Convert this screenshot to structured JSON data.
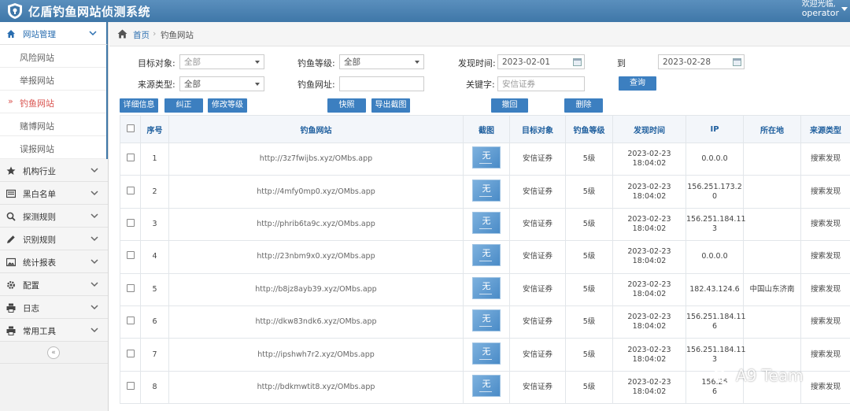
{
  "app": {
    "title": "亿盾钓鱼网站侦测系统"
  },
  "user": {
    "greeting": "欢迎光临,",
    "name": "operator"
  },
  "sidebar": {
    "groups": [
      {
        "label": "网站管理",
        "icon": "home-icon",
        "expanded": true,
        "items": [
          {
            "label": "风险网站"
          },
          {
            "label": "举报网站"
          },
          {
            "label": "钓鱼网站",
            "active": true
          },
          {
            "label": "赌博网站"
          },
          {
            "label": "误报网站"
          }
        ]
      },
      {
        "label": "机构行业",
        "icon": "star-icon"
      },
      {
        "label": "黑白名单",
        "icon": "list-icon"
      },
      {
        "label": "探测规则",
        "icon": "search-icon"
      },
      {
        "label": "识别规则",
        "icon": "pencil-icon"
      },
      {
        "label": "统计报表",
        "icon": "picture-icon"
      },
      {
        "label": "配置",
        "icon": "gear-icon"
      },
      {
        "label": "日志",
        "icon": "printer-icon"
      },
      {
        "label": "常用工具",
        "icon": "printer-icon"
      }
    ],
    "collapse_glyph": "«"
  },
  "breadcrumb": {
    "home": "首页",
    "separator": "›",
    "current": "钓鱼网站"
  },
  "filters": {
    "target_label": "目标对象:",
    "target_value": "全部",
    "level_label": "钓鱼等级:",
    "level_value": "全部",
    "found_label": "发现时间:",
    "found_from": "2023-02-01",
    "to_label": "到",
    "found_to": "2023-02-28",
    "source_label": "来源类型:",
    "source_value": "全部",
    "url_label": "钓鱼网址:",
    "url_value": "",
    "keyword_label": "关键字:",
    "keyword_placeholder": "安信证券",
    "query_button": "查询"
  },
  "toolbar": {
    "detail": "详细信息",
    "correct": "纠正",
    "change_level": "修改等级",
    "snapshot": "快照",
    "export": "导出截图",
    "revert": "撤回",
    "delete": "删除"
  },
  "table": {
    "columns": [
      "序号",
      "钓鱼网站",
      "截图",
      "目标对象",
      "钓鱼等级",
      "发现时间",
      "IP",
      "所在地",
      "来源类型"
    ],
    "thumb_text": "无",
    "rows": [
      {
        "no": "1",
        "url": "http://3z7fwijbs.xyz/OMbs.app",
        "target": "安信证券",
        "level": "5级",
        "time": "2023-02-23 18:04:02",
        "ip": "0.0.0.0",
        "loc": "",
        "src": "搜索发现"
      },
      {
        "no": "2",
        "url": "http://4mfy0mp0.xyz/OMbs.app",
        "target": "安信证券",
        "level": "5级",
        "time": "2023-02-23 18:04:02",
        "ip": "156.251.173.2\n0",
        "loc": "",
        "src": "搜索发现"
      },
      {
        "no": "3",
        "url": "http://phrib6ta9c.xyz/OMbs.app",
        "target": "安信证券",
        "level": "5级",
        "time": "2023-02-23 18:04:02",
        "ip": "156.251.184.11\n3",
        "loc": "",
        "src": "搜索发现"
      },
      {
        "no": "4",
        "url": "http://23nbm9x0.xyz/OMbs.app",
        "target": "安信证券",
        "level": "5级",
        "time": "2023-02-23 18:04:02",
        "ip": "0.0.0.0",
        "loc": "",
        "src": "搜索发现"
      },
      {
        "no": "5",
        "url": "http://b8jz8ayb39.xyz/OMbs.app",
        "target": "安信证券",
        "level": "5级",
        "time": "2023-02-23 18:04:02",
        "ip": "182.43.124.6",
        "loc": "中国山东济南",
        "src": "搜索发现"
      },
      {
        "no": "6",
        "url": "http://dkw83ndk6.xyz/OMbs.app",
        "target": "安信证券",
        "level": "5级",
        "time": "2023-02-23 18:04:02",
        "ip": "156.251.184.11\n6",
        "loc": "",
        "src": "搜索发现"
      },
      {
        "no": "7",
        "url": "http://ipshwh7r2.xyz/OMbs.app",
        "target": "安信证券",
        "level": "5级",
        "time": "2023-02-23 18:04:02",
        "ip": "156.251.184.11\n3",
        "loc": "",
        "src": "搜索发现"
      },
      {
        "no": "8",
        "url": "http://bdkmwtit8.xyz/OMbs.app",
        "target": "安信证券",
        "level": "5级",
        "time": "2023-02-23 18:04:02",
        "ip": "156.25\n6",
        "loc": "",
        "src": "搜索发现"
      }
    ]
  },
  "watermark": {
    "text": "A9 Team"
  },
  "colors": {
    "header": "#4a82b4",
    "accent": "#3c7fc0",
    "active_item": "#d9534f",
    "link": "#2a6eb0"
  }
}
